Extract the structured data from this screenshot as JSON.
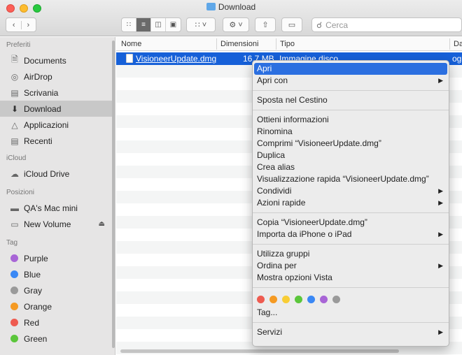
{
  "window": {
    "title": "Download"
  },
  "toolbar": {
    "search_placeholder": "Cerca"
  },
  "sidebar": {
    "sections": {
      "favorites": "Preferiti",
      "icloud": "iCloud",
      "locations": "Posizioni",
      "tags": "Tag"
    },
    "favorites": [
      {
        "label": "Documents",
        "icon": "document-icon"
      },
      {
        "label": "AirDrop",
        "icon": "airdrop-icon"
      },
      {
        "label": "Scrivania",
        "icon": "desktop-icon"
      },
      {
        "label": "Download",
        "icon": "download-icon",
        "selected": true
      },
      {
        "label": "Applicazioni",
        "icon": "applications-icon"
      },
      {
        "label": "Recenti",
        "icon": "recents-icon"
      }
    ],
    "icloud": [
      {
        "label": "iCloud Drive",
        "icon": "cloud-icon"
      }
    ],
    "locations": [
      {
        "label": "QA's Mac mini",
        "icon": "computer-icon"
      },
      {
        "label": "New Volume",
        "icon": "disk-icon"
      }
    ],
    "tags": [
      {
        "label": "Purple",
        "color": "#a865d6"
      },
      {
        "label": "Blue",
        "color": "#3a88f5"
      },
      {
        "label": "Gray",
        "color": "#9a9a9a"
      },
      {
        "label": "Orange",
        "color": "#f59a23"
      },
      {
        "label": "Red",
        "color": "#ee5b50"
      },
      {
        "label": "Green",
        "color": "#5bc63b"
      }
    ]
  },
  "file_list": {
    "columns": {
      "name": "Nome",
      "size": "Dimensioni",
      "type": "Tipo",
      "date": "Da"
    },
    "selected_file": {
      "name": "VisioneerUpdate.dmg",
      "size": "16,7 MB",
      "type": "Immagine disco",
      "date": "og"
    }
  },
  "context_menu": {
    "groups": [
      [
        {
          "label": "Apri",
          "highlighted": true
        },
        {
          "label": "Apri con",
          "submenu": true
        }
      ],
      [
        {
          "label": "Sposta nel Cestino"
        }
      ],
      [
        {
          "label": "Ottieni informazioni"
        },
        {
          "label": "Rinomina"
        },
        {
          "label": "Comprimi “VisioneerUpdate.dmg”"
        },
        {
          "label": "Duplica"
        },
        {
          "label": "Crea alias"
        },
        {
          "label": "Visualizzazione rapida “VisioneerUpdate.dmg”"
        },
        {
          "label": "Condividi",
          "submenu": true
        },
        {
          "label": "Azioni rapide",
          "submenu": true
        }
      ],
      [
        {
          "label": "Copia “VisioneerUpdate.dmg”"
        },
        {
          "label": "Importa da iPhone o iPad",
          "submenu": true
        }
      ],
      [
        {
          "label": "Utilizza gruppi"
        },
        {
          "label": "Ordina per",
          "submenu": true
        },
        {
          "label": "Mostra opzioni Vista"
        }
      ]
    ],
    "tag_colors": [
      "#ee5b50",
      "#f59a23",
      "#f8cd35",
      "#5bc63b",
      "#3a88f5",
      "#a865d6",
      "#9a9a9a"
    ],
    "tags_label": "Tag...",
    "services_label": "Servizi"
  }
}
